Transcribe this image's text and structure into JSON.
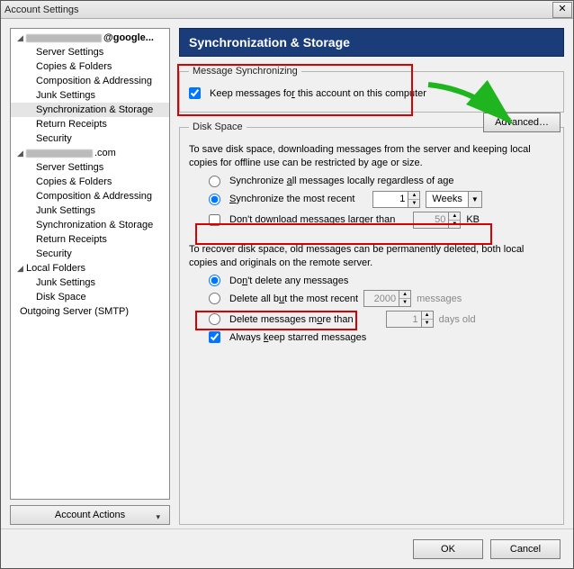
{
  "window": {
    "title": "Account Settings"
  },
  "sidebar": {
    "accounts": [
      {
        "label_suffix": "@google...",
        "items": [
          "Server Settings",
          "Copies & Folders",
          "Composition & Addressing",
          "Junk Settings",
          "Synchronization & Storage",
          "Return Receipts",
          "Security"
        ],
        "selected": 4
      },
      {
        "label_suffix": ".com",
        "items": [
          "Server Settings",
          "Copies & Folders",
          "Composition & Addressing",
          "Junk Settings",
          "Synchronization & Storage",
          "Return Receipts",
          "Security"
        ]
      },
      {
        "label": "Local Folders",
        "items": [
          "Junk Settings",
          "Disk Space"
        ]
      }
    ],
    "outgoing": "Outgoing Server (SMTP)",
    "account_actions": "Account Actions"
  },
  "page": {
    "title": "Synchronization & Storage",
    "sync_group": "Message Synchronizing",
    "keep_msgs": "Keep messages for this account on this computer",
    "keep_msgs_checked": true,
    "advanced": "Advanced…",
    "disk_group": "Disk Space",
    "disk_desc": "To save disk space, downloading messages from the server and keeping local copies for offline use can be restricted by age or size.",
    "opt_sync_all": "Synchronize all messages locally regardless of age",
    "opt_sync_recent": "Synchronize the most recent",
    "recent_value": "1",
    "recent_unit": "Weeks",
    "opt_dont_download": "Don't download messages larger than",
    "dont_download_checked": false,
    "dont_download_value": "50",
    "kb": "KB",
    "recover_desc": "To recover disk space, old messages can be permanently deleted, both local copies and originals on the remote server.",
    "opt_dont_delete": "Don't delete any messages",
    "opt_delete_recent_pre": "Delete all but the most recent",
    "opt_delete_recent_val": "2000",
    "opt_delete_recent_post": "messages",
    "opt_delete_older_pre": "Delete messages more than",
    "opt_delete_older_val": "1",
    "opt_delete_older_post": "days old",
    "opt_keep_starred": "Always keep starred messages",
    "keep_starred_checked": true,
    "sync_choice": "recent",
    "delete_choice": "none"
  },
  "footer": {
    "ok": "OK",
    "cancel": "Cancel"
  }
}
